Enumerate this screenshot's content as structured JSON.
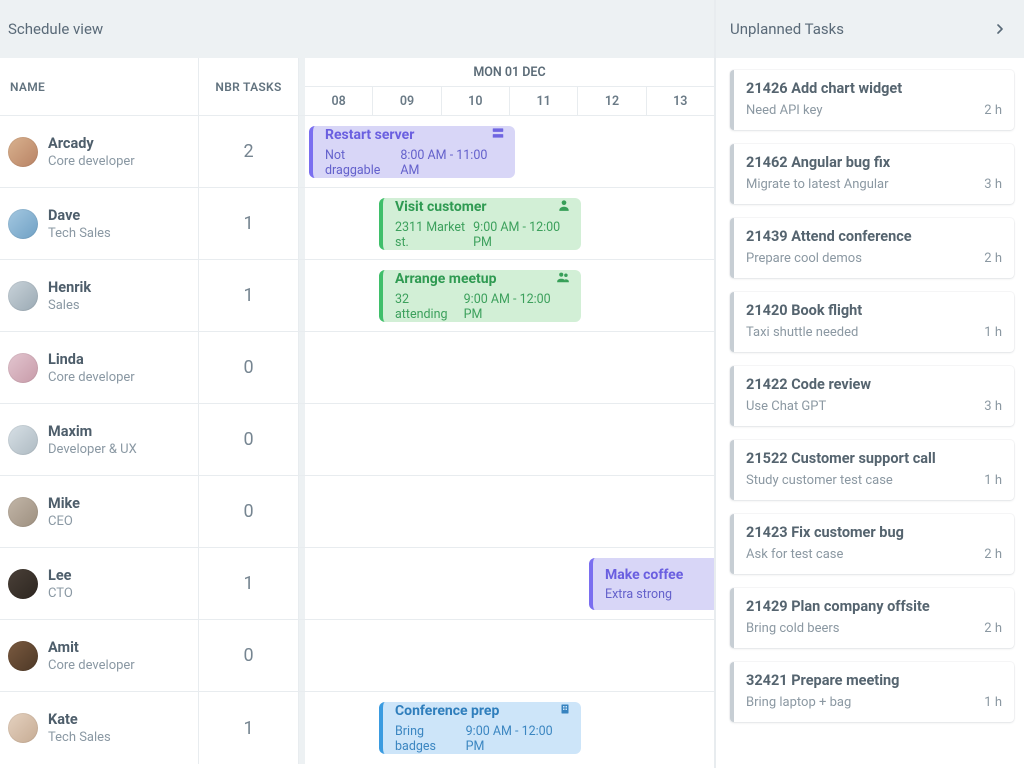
{
  "header": {
    "title": "Schedule view"
  },
  "side_header": {
    "title": "Unplanned Tasks"
  },
  "columns": {
    "name": "NAME",
    "tasks": "NBR TASKS"
  },
  "timeline": {
    "date_label": "MON 01 DEC",
    "hours": [
      "08",
      "09",
      "10",
      "11",
      "12",
      "13"
    ]
  },
  "resources": [
    {
      "name": "Arcady",
      "role": "Core developer",
      "count": "2"
    },
    {
      "name": "Dave",
      "role": "Tech Sales",
      "count": "1"
    },
    {
      "name": "Henrik",
      "role": "Sales",
      "count": "1"
    },
    {
      "name": "Linda",
      "role": "Core developer",
      "count": "0"
    },
    {
      "name": "Maxim",
      "role": "Developer & UX",
      "count": "0"
    },
    {
      "name": "Mike",
      "role": "CEO",
      "count": "0"
    },
    {
      "name": "Lee",
      "role": "CTO",
      "count": "1"
    },
    {
      "name": "Amit",
      "role": "Core developer",
      "count": "0"
    },
    {
      "name": "Kate",
      "role": "Tech Sales",
      "count": "1"
    }
  ],
  "events": {
    "arcady": {
      "title": "Restart server",
      "sub": "Not draggable",
      "time": "8:00 AM - 11:00 AM",
      "icon": "server"
    },
    "dave": {
      "title": "Visit customer",
      "sub": "2311 Market st.",
      "time": "9:00 AM - 12:00 PM",
      "icon": "user"
    },
    "henrik": {
      "title": "Arrange meetup",
      "sub": "32 attending",
      "time": "9:00 AM - 12:00 PM",
      "icon": "users"
    },
    "lee": {
      "title": "Make coffee",
      "sub": "Extra strong",
      "time": ""
    },
    "kate": {
      "title": "Conference prep",
      "sub": "Bring badges",
      "time": "9:00 AM - 12:00 PM",
      "icon": "building"
    }
  },
  "unplanned": [
    {
      "title": "21426 Add chart widget",
      "sub": "Need API key",
      "dur": "2 h"
    },
    {
      "title": "21462 Angular bug fix",
      "sub": "Migrate to latest Angular",
      "dur": "3 h"
    },
    {
      "title": "21439 Attend conference",
      "sub": "Prepare cool demos",
      "dur": "2 h"
    },
    {
      "title": "21420 Book flight",
      "sub": "Taxi shuttle needed",
      "dur": "1 h"
    },
    {
      "title": "21422 Code review",
      "sub": "Use Chat GPT",
      "dur": "3 h"
    },
    {
      "title": "21522 Customer support call",
      "sub": "Study customer test case",
      "dur": "1 h"
    },
    {
      "title": "21423 Fix customer bug",
      "sub": "Ask for test case",
      "dur": "2 h"
    },
    {
      "title": "21429 Plan company offsite",
      "sub": "Bring cold beers",
      "dur": "2 h"
    },
    {
      "title": "32421 Prepare meeting",
      "sub": "Bring laptop + bag",
      "dur": "1 h"
    }
  ]
}
